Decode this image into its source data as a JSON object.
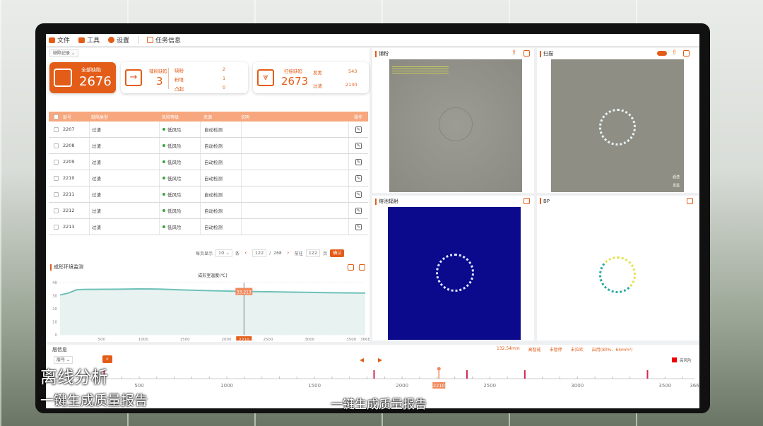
{
  "menu": {
    "file": "文件",
    "tools": "工具",
    "settings": "设置",
    "task_info": "任务信息"
  },
  "defect_tag": "缺陷记录",
  "stats": {
    "total_label": "全部缺陷",
    "total_value": "2676",
    "powder_label": "铺粉缺陷",
    "powder_value": "3",
    "powder_items": [
      {
        "k": "缺粉",
        "v": "2"
      },
      {
        "k": "粉堆",
        "v": "1"
      },
      {
        "k": "凸起",
        "v": "0"
      }
    ],
    "scan_label": "扫描缺陷",
    "scan_value": "2673",
    "scan_items": [
      {
        "k": "发黑",
        "v": "543"
      },
      {
        "k": "过渣",
        "v": "2130"
      }
    ]
  },
  "table": {
    "headers": [
      "层号",
      "缺陷类型",
      "风险等级",
      "来源",
      "说明",
      "操作"
    ],
    "rows": [
      {
        "layer": "2207",
        "type": "过渣",
        "risk": "低风险",
        "source": "自动检测"
      },
      {
        "layer": "2208",
        "type": "过渣",
        "risk": "低风险",
        "source": "自动检测"
      },
      {
        "layer": "2209",
        "type": "过渣",
        "risk": "低风险",
        "source": "自动检测"
      },
      {
        "layer": "2210",
        "type": "过渣",
        "risk": "低风险",
        "source": "自动检测"
      },
      {
        "layer": "2211",
        "type": "过渣",
        "risk": "低风险",
        "source": "自动检测"
      },
      {
        "layer": "2212",
        "type": "过渣",
        "risk": "低风险",
        "source": "自动检测"
      },
      {
        "layer": "2213",
        "type": "过渣",
        "risk": "低风险",
        "source": "自动检测"
      }
    ]
  },
  "pager": {
    "per_page_label": "每页显示",
    "per_page": "10",
    "unit": "条",
    "current": "122",
    "sep": "/",
    "total": "268",
    "goto_label": "前往",
    "goto_value": "122",
    "page_unit": "页",
    "confirm": "确认"
  },
  "env": {
    "title": "成形环境监测",
    "chart_title": "成形室温度(℃)",
    "marker_value": "33.213",
    "marker_x": "2210"
  },
  "views": {
    "powder": "铺粉",
    "scan": "扫描",
    "melt": "熔池辐射",
    "bp": "BP",
    "legend": [
      "過渣",
      "发黑"
    ]
  },
  "layer": {
    "title": "层信息",
    "select": "层号",
    "info": [
      "132.54mm",
      "高智能",
      "未暂停",
      "未拉欢",
      "启用(80%、64mm²)"
    ],
    "legend": "高风险",
    "current": "2210"
  },
  "captions": {
    "left_title": "离线分析",
    "left_sub": "一键生成质量报告",
    "center": "一键生成质量报告"
  },
  "colors": {
    "accent": "#e35d18",
    "header": "#f7a77e",
    "teal": "#6ec1b8",
    "melt_bg": "#0c0a8c"
  },
  "chart_data": [
    {
      "type": "line",
      "title": "成形室温度(℃)",
      "xlabel": "",
      "ylabel": "",
      "xlim": [
        0,
        3668
      ],
      "ylim": [
        0,
        40
      ],
      "x_ticks": [
        500,
        1000,
        1500,
        2000,
        2500,
        3000,
        3500,
        3668
      ],
      "y_ticks": [
        0,
        10,
        20,
        30,
        40
      ],
      "series": [
        {
          "x": [
            0,
            100,
            200,
            300,
            700,
            1000,
            1200,
            1500,
            1700,
            2000,
            2210,
            2500,
            3000,
            3300,
            3668
          ],
          "y": [
            30.5,
            32,
            34.5,
            34.8,
            34.9,
            35.2,
            35.0,
            34.3,
            34.0,
            33.5,
            33.213,
            33.0,
            32.5,
            32.2,
            32.0
          ]
        }
      ],
      "annotations": [
        "33.213",
        "2210"
      ]
    },
    {
      "type": "scatter",
      "title": "",
      "xlim": [
        0,
        3668
      ],
      "x_ticks": [
        500,
        1000,
        1500,
        2000,
        2500,
        3000,
        3500,
        3668
      ],
      "x_tick_labels": [
        "500",
        "1000",
        "1500",
        "2000",
        "2500",
        "3000",
        "3500",
        "366"
      ],
      "markers": [
        300,
        1840,
        2370,
        2700,
        3400
      ],
      "current": 2210
    }
  ]
}
